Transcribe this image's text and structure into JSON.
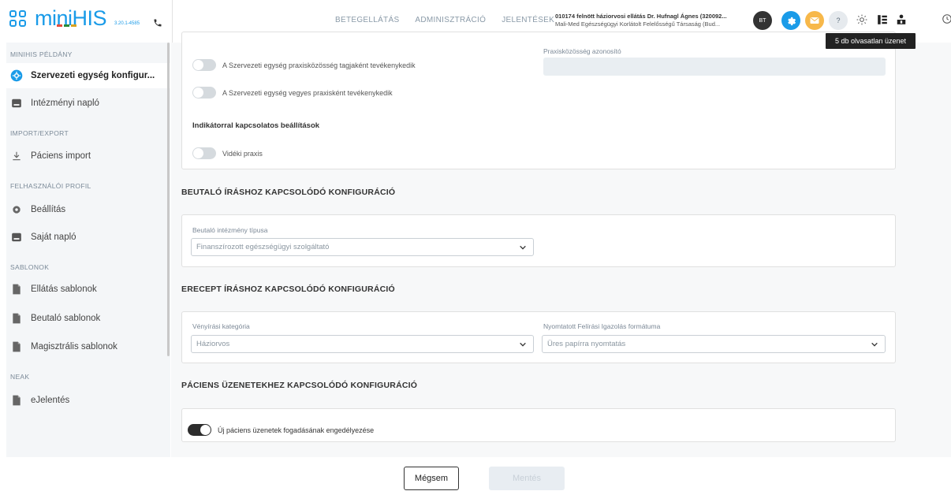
{
  "app": {
    "logo_text_mini": "mini",
    "logo_text_his": "HIS",
    "version": "3.20.1-4585"
  },
  "topnav": {
    "items": [
      "BETEGELLÁTÁS",
      "ADMINISZTRÁCIÓ",
      "JELENTÉSEK"
    ]
  },
  "org": {
    "line1": "010174 felnött háziorvosi ellátás Dr. Hufnagl Ágnes (320092...",
    "line2": "Mali-Med Egészségügyi Korlátolt Felelősségű Társaság (Bud..."
  },
  "user": {
    "initials": "BT"
  },
  "help": {
    "label": "?"
  },
  "tooltip": {
    "text": "5 db olvasatlan üzenet"
  },
  "sidebar": {
    "sections": {
      "minihis": "MINIHIS PÉLDÁNY",
      "import": "IMPORT/EXPORT",
      "profile": "FELHASZNÁLÓI PROFIL",
      "templates": "SABLONOK",
      "neak": "NEAK"
    },
    "items": {
      "org_config": "Szervezeti egység konfigur...",
      "inst_log": "Intézményi napló",
      "patient_import": "Páciens import",
      "settings": "Beállítás",
      "own_log": "Saját napló",
      "care_templates": "Ellátás sablonok",
      "referral_templates": "Beutaló sablonok",
      "magistral_templates": "Magisztrális sablonok",
      "ereport": "eJelentés"
    }
  },
  "practice": {
    "toggle1": "A Szervezeti egység praxisközösség tagjaként tevékenykedik",
    "toggle2": "A Szervezeti egység vegyes praxisként tevékenykedik",
    "community_id_label": "Praxisközösség azonosító",
    "community_id_value": "",
    "indicator_heading": "Indikátorral kapcsolatos beállítások",
    "rural_label": "Vidéki praxis"
  },
  "referral": {
    "title": "BEUTALÓ ÍRÁSHOZ KAPCSOLÓDÓ KONFIGURÁCIÓ",
    "type_label": "Beutaló intézmény típusa",
    "type_value": "Finanszírozott egészségügyi szolgáltató"
  },
  "erecept": {
    "title": "ERECEPT ÍRÁSHOZ KAPCSOLÓDÓ KONFIGURÁCIÓ",
    "category_label": "Vényírási kategória",
    "category_value": "Háziorvos",
    "format_label": "Nyomtatott Felírási Igazolás formátuma",
    "format_value": "Üres papírra nyomtatás"
  },
  "messages": {
    "title": "PÁCIENS ÜZENETEKHEZ KAPCSOLÓDÓ KONFIGURÁCIÓ",
    "toggle_label": "Új páciens üzenetek fogadásának engedélyezése",
    "toggle_on": true
  },
  "footer": {
    "cancel": "Mégsem",
    "save": "Mentés"
  },
  "colors": {
    "accent": "#1a9be8",
    "mail": "#f7b84a",
    "toggle_on": "#2d2d2d"
  }
}
